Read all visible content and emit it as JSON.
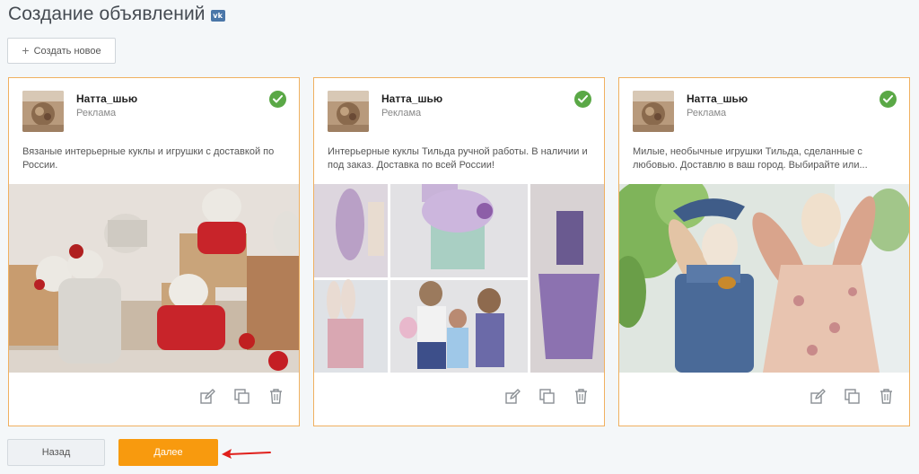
{
  "header": {
    "title": "Создание объявлений",
    "vk_icon": "vk-logo-icon"
  },
  "toolbar": {
    "create_label": "Создать новое",
    "create_icon": "plus-icon"
  },
  "cards": [
    {
      "account": "Натта_шью",
      "subtitle": "Реклама",
      "text": "Вязаные интерьерные куклы и игрушки с доставкой по России.",
      "status_icon": "check-circle-icon"
    },
    {
      "account": "Натта_шью",
      "subtitle": "Реклама",
      "text": "Интерьерные куклы Тильда ручной работы. В наличии и под заказ. Доставка по всей России!",
      "status_icon": "check-circle-icon"
    },
    {
      "account": "Натта_шью",
      "subtitle": "Реклама",
      "text": "Милые, необычные игрушки Тильда, сделанные с любовью. Доставлю в ваш город. Выбирайте или...",
      "status_icon": "check-circle-icon"
    }
  ],
  "card_actions": [
    "edit-icon",
    "copy-icon",
    "trash-icon"
  ],
  "footer": {
    "back_label": "Назад",
    "next_label": "Далее"
  },
  "colors": {
    "accent": "#f89a0e",
    "card_border": "#f0b060",
    "check": "#5aa846",
    "arrow": "#e0201c"
  }
}
